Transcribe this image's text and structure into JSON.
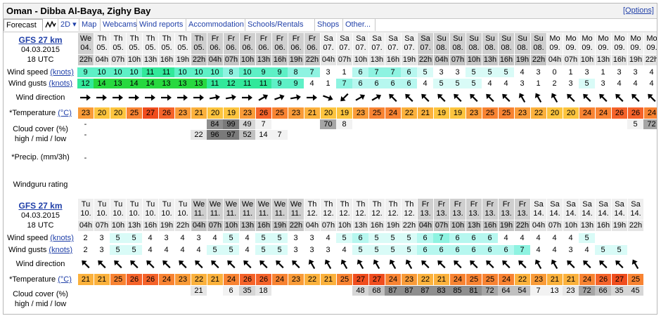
{
  "header": {
    "title": "Oman - Dibba Al-Baya, Zighy Bay",
    "options_label": "[Options]"
  },
  "tabs": [
    {
      "label": "Forecast",
      "active": true
    },
    {
      "label": "2D"
    },
    {
      "label": "Map"
    },
    {
      "label": "Webcams"
    },
    {
      "label": "Wind reports"
    },
    {
      "label": "Accommodation"
    },
    {
      "label": "Schools/Rentals"
    },
    {
      "label": "Shops"
    },
    {
      "label": "Other..."
    }
  ],
  "labels": {
    "wind_speed": "Wind speed",
    "wind_gusts": "Wind gusts",
    "knots": "(knots)",
    "wind_direction": "Wind direction",
    "temperature": "*Temperature",
    "celsius": "(°C)",
    "cloud_cover": "Cloud cover (%)",
    "cloud_levels": "high / mid / low",
    "precip": "*Precip. (mm/3h)",
    "rating": "Windguru rating"
  },
  "sections": [
    {
      "model": "GFS 27 km",
      "date": "04.03.2015",
      "utc": "18 UTC",
      "columns": [
        {
          "d": "We",
          "n": "04.",
          "h": "22h",
          "w": 1
        },
        {
          "d": "Th",
          "n": "05.",
          "h": "04h"
        },
        {
          "d": "Th",
          "n": "05.",
          "h": "07h"
        },
        {
          "d": "Th",
          "n": "05.",
          "h": "10h"
        },
        {
          "d": "Th",
          "n": "05.",
          "h": "13h"
        },
        {
          "d": "Th",
          "n": "05.",
          "h": "16h"
        },
        {
          "d": "Th",
          "n": "05.",
          "h": "19h"
        },
        {
          "d": "Th",
          "n": "05.",
          "h": "22h",
          "w": 1
        },
        {
          "d": "Fr",
          "n": "06.",
          "h": "04h",
          "w": 1
        },
        {
          "d": "Fr",
          "n": "06.",
          "h": "07h",
          "w": 1
        },
        {
          "d": "Fr",
          "n": "06.",
          "h": "10h",
          "w": 1
        },
        {
          "d": "Fr",
          "n": "06.",
          "h": "13h",
          "w": 1
        },
        {
          "d": "Fr",
          "n": "06.",
          "h": "16h",
          "w": 1
        },
        {
          "d": "Fr",
          "n": "06.",
          "h": "19h",
          "w": 1
        },
        {
          "d": "Fr",
          "n": "06.",
          "h": "22h",
          "w": 1
        },
        {
          "d": "Sa",
          "n": "07.",
          "h": "04h"
        },
        {
          "d": "Sa",
          "n": "07.",
          "h": "07h"
        },
        {
          "d": "Sa",
          "n": "07.",
          "h": "10h"
        },
        {
          "d": "Sa",
          "n": "07.",
          "h": "13h"
        },
        {
          "d": "Sa",
          "n": "07.",
          "h": "16h"
        },
        {
          "d": "Sa",
          "n": "07.",
          "h": "19h"
        },
        {
          "d": "Sa",
          "n": "07.",
          "h": "22h",
          "w": 1
        },
        {
          "d": "Su",
          "n": "08.",
          "h": "04h",
          "w": 1
        },
        {
          "d": "Su",
          "n": "08.",
          "h": "07h",
          "w": 1
        },
        {
          "d": "Su",
          "n": "08.",
          "h": "10h",
          "w": 1
        },
        {
          "d": "Su",
          "n": "08.",
          "h": "13h",
          "w": 1
        },
        {
          "d": "Su",
          "n": "08.",
          "h": "16h",
          "w": 1
        },
        {
          "d": "Su",
          "n": "08.",
          "h": "19h",
          "w": 1
        },
        {
          "d": "Su",
          "n": "08.",
          "h": "22h",
          "w": 1
        },
        {
          "d": "Mo",
          "n": "09.",
          "h": "04h"
        },
        {
          "d": "Mo",
          "n": "09.",
          "h": "07h"
        },
        {
          "d": "Mo",
          "n": "09.",
          "h": "10h"
        },
        {
          "d": "Mo",
          "n": "09.",
          "h": "13h"
        },
        {
          "d": "Mo",
          "n": "09.",
          "h": "16h"
        },
        {
          "d": "Mo",
          "n": "09.",
          "h": "19h"
        },
        {
          "d": "Mo",
          "n": "09.",
          "h": "22h"
        }
      ],
      "wind_speed": [
        9,
        10,
        10,
        10,
        11,
        11,
        10,
        10,
        10,
        8,
        10,
        9,
        9,
        8,
        7,
        3,
        1,
        6,
        7,
        7,
        6,
        5,
        3,
        3,
        5,
        5,
        5,
        4,
        3,
        0,
        1,
        3,
        1,
        3,
        3,
        4
      ],
      "wind_gusts": [
        12,
        14,
        13,
        14,
        14,
        13,
        13,
        13,
        11,
        12,
        11,
        11,
        9,
        9,
        4,
        1,
        7,
        6,
        6,
        6,
        6,
        4,
        5,
        5,
        5,
        4,
        4,
        3,
        1,
        2,
        3,
        5,
        3,
        4,
        4,
        4
      ],
      "wind_dir": [
        90,
        90,
        90,
        90,
        90,
        90,
        90,
        90,
        80,
        80,
        90,
        60,
        70,
        80,
        90,
        110,
        225,
        60,
        60,
        315,
        315,
        315,
        315,
        315,
        315,
        315,
        315,
        330,
        330,
        330,
        315,
        315,
        315,
        315,
        315,
        315
      ],
      "temperature": [
        23,
        20,
        20,
        25,
        27,
        26,
        23,
        21,
        20,
        19,
        23,
        26,
        25,
        23,
        21,
        20,
        19,
        23,
        25,
        24,
        22,
        21,
        19,
        19,
        23,
        25,
        25,
        23,
        22,
        20,
        20,
        24,
        24,
        26,
        26,
        24,
        23
      ],
      "cloud_high": [
        "-",
        "",
        "",
        "",
        "",
        "",
        "",
        "",
        "84",
        "99",
        "49",
        "7",
        "",
        "",
        "",
        "70",
        "8",
        "",
        "",
        "",
        "",
        "",
        "",
        "",
        "",
        "",
        "",
        "",
        "",
        "",
        "",
        "",
        "",
        "",
        "5",
        "72",
        "74"
      ],
      "cloud_mid": [
        "-",
        "",
        "",
        "",
        "",
        "",
        "",
        "22",
        "96",
        "97",
        "52",
        "14",
        "7",
        "",
        "",
        "",
        "",
        "",
        "",
        "",
        "",
        "",
        "",
        "",
        "",
        "",
        "",
        "",
        "",
        "",
        "",
        "",
        "",
        "",
        "",
        "",
        ""
      ],
      "precip_first": "-"
    },
    {
      "model": "GFS 27 km",
      "date": "04.03.2015",
      "utc": "18 UTC",
      "columns": [
        {
          "d": "Tu",
          "n": "10.",
          "h": "04h"
        },
        {
          "d": "Tu",
          "n": "10.",
          "h": "07h"
        },
        {
          "d": "Tu",
          "n": "10.",
          "h": "10h"
        },
        {
          "d": "Tu",
          "n": "10.",
          "h": "13h"
        },
        {
          "d": "Tu",
          "n": "10.",
          "h": "16h"
        },
        {
          "d": "Tu",
          "n": "10.",
          "h": "19h"
        },
        {
          "d": "Tu",
          "n": "10.",
          "h": "22h"
        },
        {
          "d": "We",
          "n": "11.",
          "h": "04h",
          "w": 1
        },
        {
          "d": "We",
          "n": "11.",
          "h": "07h",
          "w": 1
        },
        {
          "d": "We",
          "n": "11.",
          "h": "10h",
          "w": 1
        },
        {
          "d": "We",
          "n": "11.",
          "h": "13h",
          "w": 1
        },
        {
          "d": "We",
          "n": "11.",
          "h": "16h",
          "w": 1
        },
        {
          "d": "We",
          "n": "11.",
          "h": "19h",
          "w": 1
        },
        {
          "d": "We",
          "n": "11.",
          "h": "22h",
          "w": 1
        },
        {
          "d": "Th",
          "n": "12.",
          "h": "04h"
        },
        {
          "d": "Th",
          "n": "12.",
          "h": "07h"
        },
        {
          "d": "Th",
          "n": "12.",
          "h": "10h"
        },
        {
          "d": "Th",
          "n": "12.",
          "h": "13h"
        },
        {
          "d": "Th",
          "n": "12.",
          "h": "16h"
        },
        {
          "d": "Th",
          "n": "12.",
          "h": "19h"
        },
        {
          "d": "Th",
          "n": "12.",
          "h": "22h"
        },
        {
          "d": "Fr",
          "n": "13.",
          "h": "04h",
          "w": 1
        },
        {
          "d": "Fr",
          "n": "13.",
          "h": "07h",
          "w": 1
        },
        {
          "d": "Fr",
          "n": "13.",
          "h": "10h",
          "w": 1
        },
        {
          "d": "Fr",
          "n": "13.",
          "h": "13h",
          "w": 1
        },
        {
          "d": "Fr",
          "n": "13.",
          "h": "16h",
          "w": 1
        },
        {
          "d": "Fr",
          "n": "13.",
          "h": "19h",
          "w": 1
        },
        {
          "d": "Fr",
          "n": "13.",
          "h": "22h",
          "w": 1
        },
        {
          "d": "Sa",
          "n": "14.",
          "h": "04h"
        },
        {
          "d": "Sa",
          "n": "14.",
          "h": "07h"
        },
        {
          "d": "Sa",
          "n": "14.",
          "h": "10h"
        },
        {
          "d": "Sa",
          "n": "14.",
          "h": "13h"
        },
        {
          "d": "Sa",
          "n": "14.",
          "h": "16h"
        },
        {
          "d": "Sa",
          "n": "14.",
          "h": "19h"
        },
        {
          "d": "Sa",
          "n": "14.",
          "h": "22h"
        }
      ],
      "wind_speed": [
        2,
        3,
        5,
        5,
        4,
        3,
        4,
        3,
        4,
        5,
        4,
        5,
        5,
        3,
        3,
        4,
        5,
        6,
        5,
        5,
        5,
        6,
        7,
        6,
        6,
        6,
        4,
        4,
        4,
        4,
        4,
        5
      ],
      "wind_gusts": [
        2,
        3,
        5,
        5,
        4,
        4,
        4,
        4,
        5,
        5,
        4,
        5,
        5,
        3,
        3,
        3,
        4,
        5,
        5,
        5,
        5,
        6,
        6,
        6,
        6,
        6,
        6,
        7,
        4,
        4,
        3,
        4,
        5,
        5
      ],
      "wind_dir": [
        315,
        315,
        315,
        315,
        315,
        315,
        315,
        315,
        315,
        315,
        315,
        315,
        315,
        315,
        330,
        330,
        330,
        330,
        330,
        330,
        330,
        315,
        315,
        315,
        315,
        315,
        315,
        315,
        330,
        330,
        315,
        315,
        315,
        315,
        330
      ],
      "temperature": [
        21,
        21,
        25,
        26,
        26,
        24,
        23,
        22,
        21,
        24,
        26,
        26,
        24,
        23,
        22,
        21,
        25,
        27,
        27,
        24,
        23,
        22,
        21,
        24,
        25,
        25,
        24,
        22,
        23,
        21,
        21,
        24,
        26,
        27,
        25,
        24
      ],
      "cloud_high": [
        "",
        "",
        "",
        "",
        "",
        "",
        "",
        "21",
        "",
        "6",
        "35",
        "18",
        "",
        "",
        "",
        "",
        "",
        "48",
        "68",
        "87",
        "87",
        "87",
        "83",
        "85",
        "81",
        "72",
        "64",
        "54",
        "7",
        "13",
        "23",
        "72",
        "66",
        "35",
        "45"
      ],
      "cloud_mid": []
    }
  ]
}
